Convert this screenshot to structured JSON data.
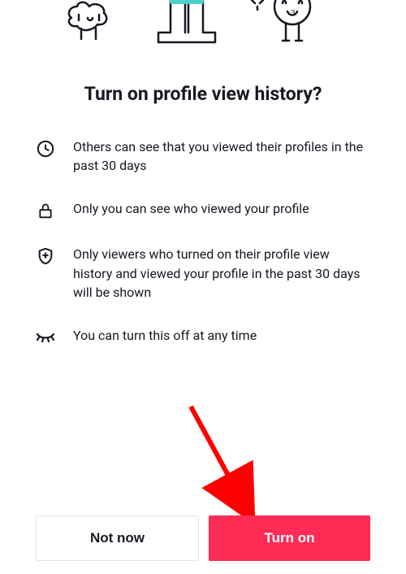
{
  "title": "Turn on profile view history?",
  "features": [
    {
      "icon": "clock-icon",
      "text": "Others can see that you viewed their profiles in the past 30 days"
    },
    {
      "icon": "lock-icon",
      "text": "Only you can see who viewed your profile"
    },
    {
      "icon": "shield-plus-icon",
      "text": "Only viewers who turned on their profile view history and viewed your profile in the past 30 days will be shown"
    },
    {
      "icon": "closed-eye-icon",
      "text": "You can turn this off at any time"
    }
  ],
  "buttons": {
    "secondary_label": "Not now",
    "primary_label": "Turn on"
  }
}
